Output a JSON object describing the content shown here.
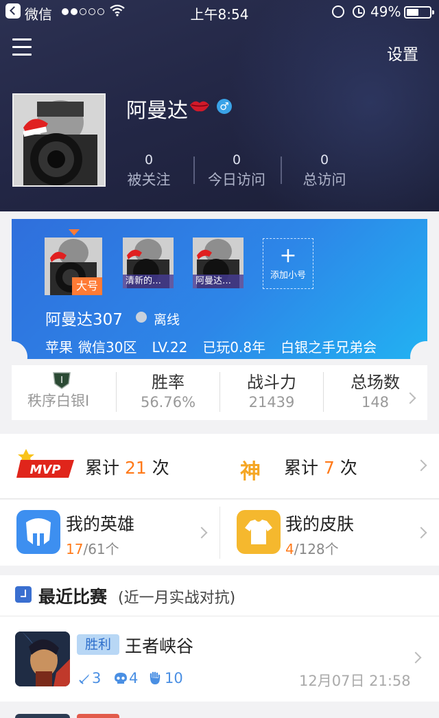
{
  "status_bar": {
    "carrier": "微信",
    "time": "上午8:54",
    "battery": "49%"
  },
  "header": {
    "settings_label": "设置",
    "username": "阿曼达",
    "gender_symbol": "♂",
    "stats": [
      {
        "value": "0",
        "label": "被关注"
      },
      {
        "value": "0",
        "label": "今日访问"
      },
      {
        "value": "0",
        "label": "总访问"
      }
    ]
  },
  "accounts": {
    "main_tag": "大号",
    "items": [
      {
        "caption": "清新的…"
      },
      {
        "caption": "阿曼达…"
      }
    ],
    "add_label": "添加小号",
    "plus": "+",
    "current_name": "阿曼达307",
    "status": "离线",
    "info": {
      "platform": "苹果",
      "server": "微信30区",
      "level": "LV.22",
      "played": "已玩0.8年",
      "guild": "白银之手兄弟会"
    }
  },
  "stats_row": {
    "rank": "秩序白银I",
    "rank_badge": "I",
    "columns": [
      {
        "title": "胜率",
        "value": "56.76%"
      },
      {
        "title": "战斗力",
        "value": "21439"
      },
      {
        "title": "总场数",
        "value": "148"
      }
    ]
  },
  "honors": {
    "mvp_badge": "MVP",
    "mvp_prefix": "累计",
    "mvp_count": "21",
    "mvp_suffix": "次",
    "god_badge": "神",
    "god_prefix": "累计",
    "god_count": "7",
    "god_suffix": "次"
  },
  "collection": {
    "heroes_title": "我的英雄",
    "heroes_owned": "17",
    "heroes_total": "/61个",
    "skins_title": "我的皮肤",
    "skins_owned": "4",
    "skins_total": "/128个"
  },
  "recent": {
    "title": "最近比赛",
    "subtitle": "(近一月实战对抗)",
    "match": {
      "result": "胜利",
      "map": "王者峡谷",
      "kills": "3",
      "deaths": "4",
      "assists": "10",
      "time": "12月07日 21:58"
    }
  },
  "colors": {
    "header_bg": "#232746",
    "card_blue": "#2d86e8",
    "accent_orange": "#ff7a1a",
    "win_blue": "#2e6fcb"
  }
}
